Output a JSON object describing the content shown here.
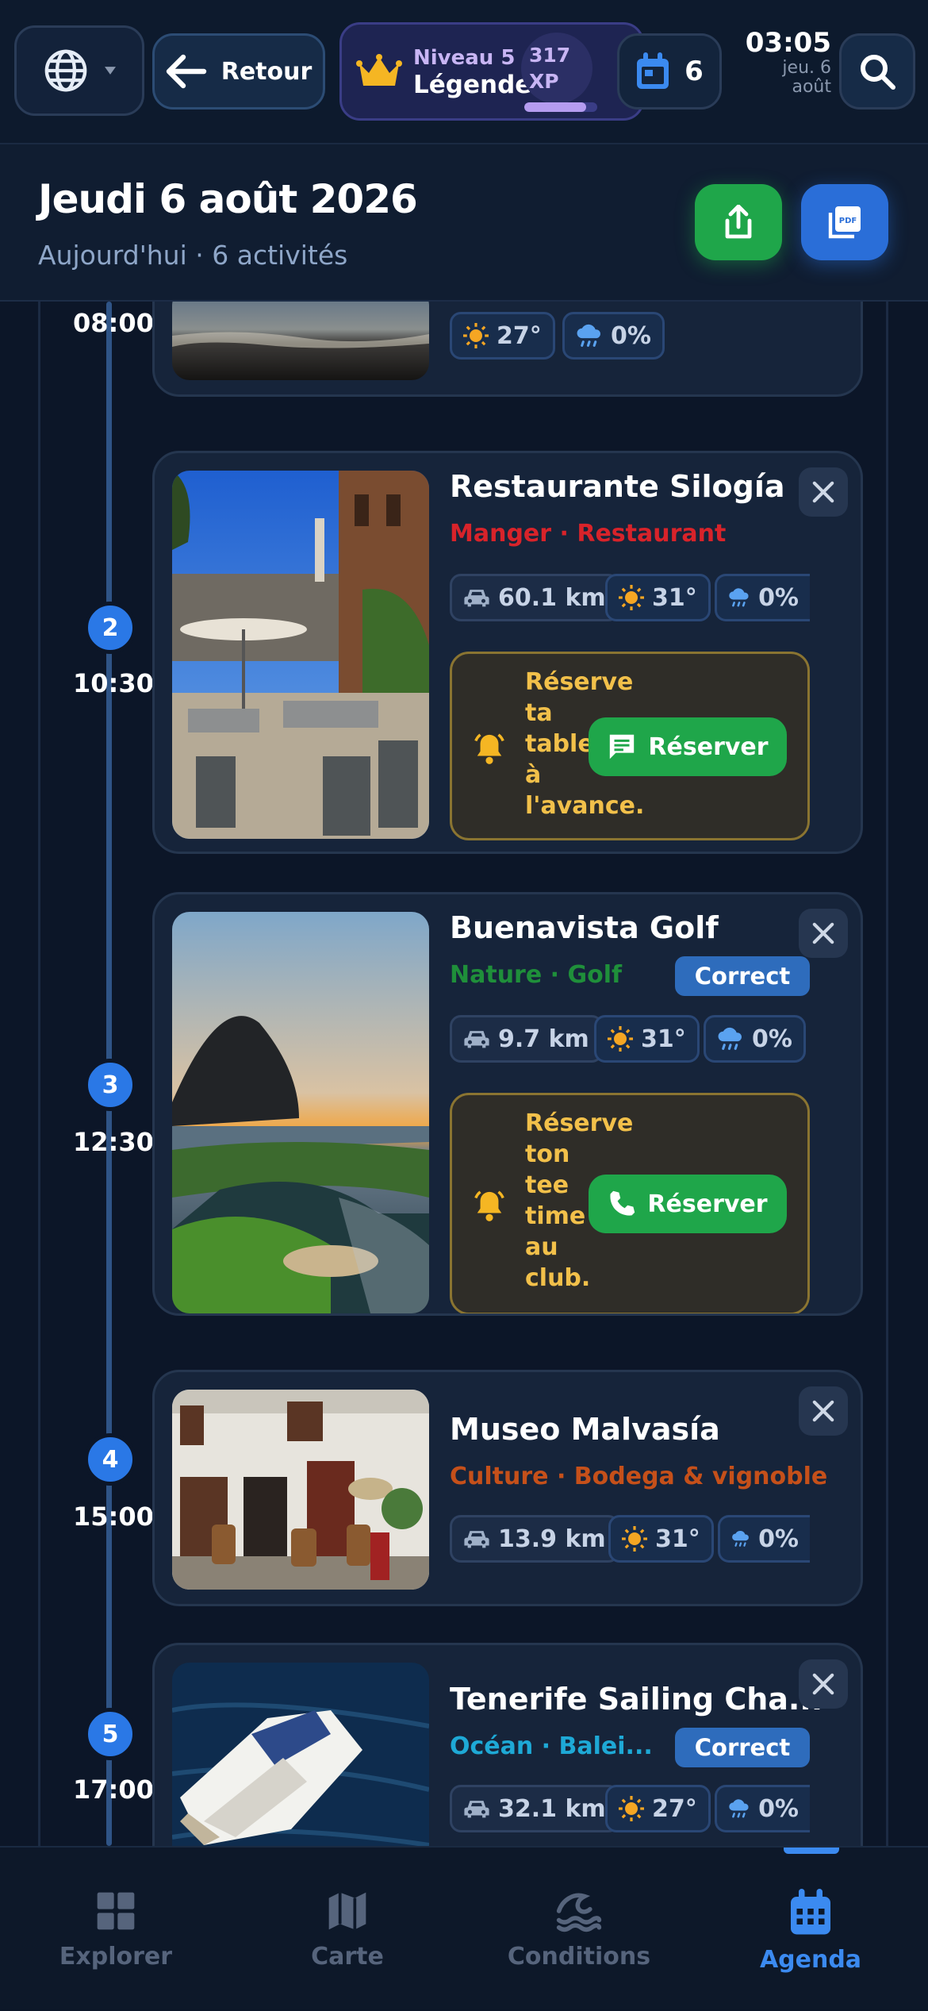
{
  "topbar": {
    "back_label": "Retour",
    "level_label": "Niveau 5",
    "rank_label": "Légende",
    "xp_value": "317",
    "xp_unit": "XP",
    "xp_progress": 0.85,
    "calendar_count": "6",
    "clock_time": "03:05",
    "clock_day": "jeu. 6",
    "clock_month": "août"
  },
  "header": {
    "title": "Jeudi 6 août 2026",
    "subtitle": "Aujourd'hui · 6 activités"
  },
  "timeline": {
    "first": {
      "time": "08:00",
      "temp": "27°",
      "rain": "0%"
    },
    "items": [
      {
        "step": "2",
        "time": "10:30",
        "title": "Restaurante Silogía",
        "category": "Manger · Restaurant",
        "distance": "60.1 km",
        "temp": "31°",
        "rain": "0%",
        "alert": "Réserve ta table à l'avance.",
        "button": "Réserver"
      },
      {
        "step": "3",
        "time": "12:30",
        "title": "Buenavista Golf",
        "category": "Nature · Golf",
        "badge": "Correct",
        "distance": "9.7 km",
        "temp": "31°",
        "rain": "0%",
        "alert": "Réserve ton tee time au club.",
        "button": "Réserver"
      },
      {
        "step": "4",
        "time": "15:00",
        "title": "Museo Malvasía",
        "category": "Culture · Bodega & vignoble",
        "distance": "13.9 km",
        "temp": "31°",
        "rain": "0%"
      },
      {
        "step": "5",
        "time": "17:00",
        "title": "Tenerife Sailing Cha...",
        "category": "Océan · Balei...",
        "badge": "Correct",
        "distance": "32.1 km",
        "temp": "27°",
        "rain": "0%"
      }
    ]
  },
  "nav": {
    "explorer": "Explorer",
    "carte": "Carte",
    "conditions": "Conditions",
    "agenda": "Agenda"
  },
  "colors": {
    "accent": "#2a78e6",
    "success": "#1fa64a",
    "warning": "#f2c04a",
    "manger": "#d8232a",
    "nature": "#1f8f3a",
    "culture": "#c5501a",
    "ocean": "#1ea9d6"
  }
}
